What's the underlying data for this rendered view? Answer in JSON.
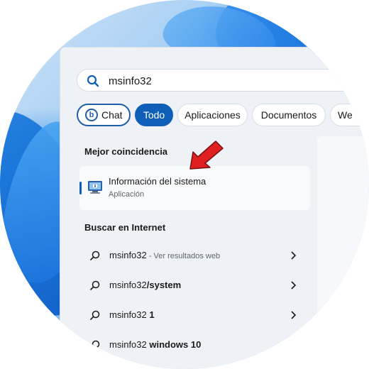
{
  "search": {
    "value": "msinfo32",
    "icon": "search-icon"
  },
  "filters": {
    "chat": "Chat",
    "todo": "Todo",
    "aplicaciones": "Aplicaciones",
    "documentos": "Documentos",
    "web_partial": "We"
  },
  "best_match": {
    "section_title": "Mejor coincidencia",
    "name": "Información del sistema",
    "type": "Aplicación"
  },
  "internet": {
    "section_title": "Buscar en Internet",
    "results": [
      {
        "query": "msinfo32",
        "bold": "",
        "suffix": " - Ver resultados web"
      },
      {
        "query": "msinfo32",
        "bold": "/system",
        "suffix": ""
      },
      {
        "query": "msinfo32",
        "bold": " 1",
        "suffix": ""
      },
      {
        "query": "msinfo32",
        "bold": " windows 10",
        "suffix": ""
      }
    ]
  },
  "colors": {
    "accent": "#0f5fb8",
    "annotation_arrow": "#e02020"
  }
}
